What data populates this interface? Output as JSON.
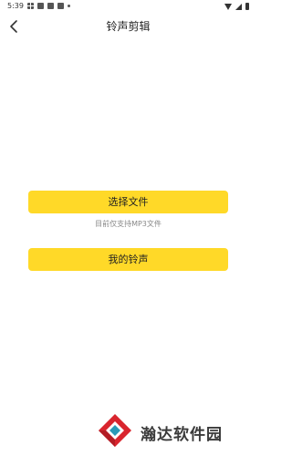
{
  "status_bar": {
    "time": "5:39",
    "left_icons": [
      "grid-icon",
      "app-icon",
      "app-icon",
      "app-icon",
      "dot-icon"
    ],
    "right_icons": [
      "wifi-icon",
      "signal-icon",
      "battery-icon"
    ]
  },
  "header": {
    "back_icon": "chevron-left-icon",
    "title": "铃声剪辑"
  },
  "main": {
    "select_file_label": "选择文件",
    "hint": "目前仅支持MP3文件",
    "my_ringtones_label": "我的铃声"
  },
  "watermark": {
    "text": "瀚达软件园"
  },
  "colors": {
    "accent": "#FFD928",
    "title_text": "#222222",
    "hint_text": "#888888",
    "background": "#FFFFFF"
  }
}
